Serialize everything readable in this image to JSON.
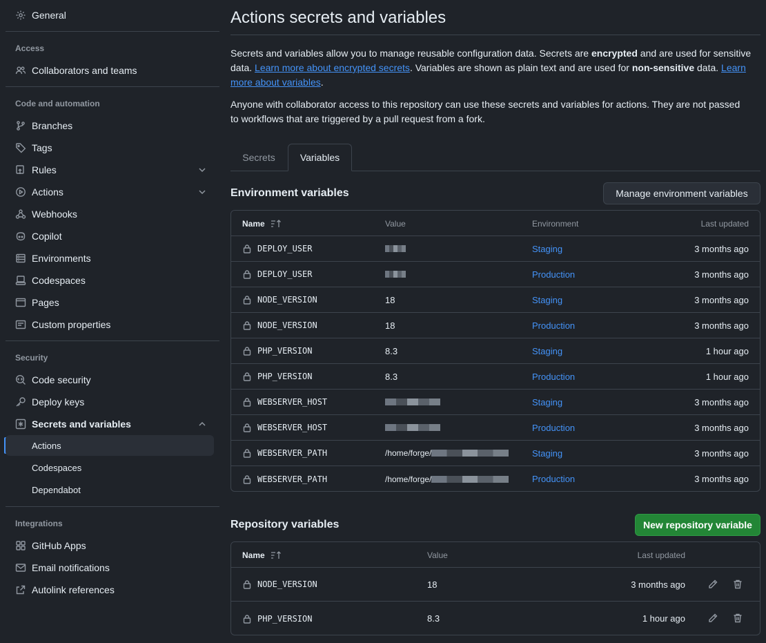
{
  "sidebar": {
    "general": "General",
    "section_access": "Access",
    "collaborators": "Collaborators and teams",
    "section_code": "Code and automation",
    "branches": "Branches",
    "tags": "Tags",
    "rules": "Rules",
    "actions": "Actions",
    "webhooks": "Webhooks",
    "copilot": "Copilot",
    "environments": "Environments",
    "codespaces": "Codespaces",
    "pages": "Pages",
    "custom_properties": "Custom properties",
    "section_security": "Security",
    "code_security": "Code security",
    "deploy_keys": "Deploy keys",
    "secrets_variables": "Secrets and variables",
    "sub_actions": "Actions",
    "sub_codespaces": "Codespaces",
    "sub_dependabot": "Dependabot",
    "section_integrations": "Integrations",
    "github_apps": "GitHub Apps",
    "email_notifications": "Email notifications",
    "autolink_references": "Autolink references"
  },
  "main": {
    "title": "Actions secrets and variables",
    "intro": {
      "t1": "Secrets and variables allow you to manage reusable configuration data. Secrets are ",
      "b1": "encrypted",
      "t2": " and are used for sensitive data. ",
      "link1": "Learn more about encrypted secrets",
      "t3": ". Variables are shown as plain text and are used for ",
      "b2": "non-sensitive",
      "t4": " data. ",
      "link2": "Learn more about variables",
      "t5": "."
    },
    "access_note": "Anyone with collaborator access to this repository can use these secrets and variables for actions. They are not passed to workflows that are triggered by a pull request from a fork.",
    "tabs": {
      "secrets": "Secrets",
      "variables": "Variables"
    },
    "env_section": {
      "title": "Environment variables",
      "manage_button": "Manage environment variables",
      "headers": {
        "name": "Name",
        "value": "Value",
        "environment": "Environment",
        "last_updated": "Last updated"
      },
      "rows": [
        {
          "name": "DEPLOY_USER",
          "value": "",
          "environment": "Staging",
          "updated": "3 months ago"
        },
        {
          "name": "DEPLOY_USER",
          "value": "",
          "environment": "Production",
          "updated": "3 months ago"
        },
        {
          "name": "NODE_VERSION",
          "value": "18",
          "environment": "Staging",
          "updated": "3 months ago"
        },
        {
          "name": "NODE_VERSION",
          "value": "18",
          "environment": "Production",
          "updated": "3 months ago"
        },
        {
          "name": "PHP_VERSION",
          "value": "8.3",
          "environment": "Staging",
          "updated": "1 hour ago"
        },
        {
          "name": "PHP_VERSION",
          "value": "8.3",
          "environment": "Production",
          "updated": "1 hour ago"
        },
        {
          "name": "WEBSERVER_HOST",
          "value": "",
          "environment": "Staging",
          "updated": "3 months ago"
        },
        {
          "name": "WEBSERVER_HOST",
          "value": "",
          "environment": "Production",
          "updated": "3 months ago"
        },
        {
          "name": "WEBSERVER_PATH",
          "value": "/home/forge/",
          "environment": "Staging",
          "updated": "3 months ago"
        },
        {
          "name": "WEBSERVER_PATH",
          "value": "/home/forge/",
          "environment": "Production",
          "updated": "3 months ago"
        }
      ]
    },
    "repo_section": {
      "title": "Repository variables",
      "new_button": "New repository variable",
      "headers": {
        "name": "Name",
        "value": "Value",
        "last_updated": "Last updated"
      },
      "rows": [
        {
          "name": "NODE_VERSION",
          "value": "18",
          "updated": "3 months ago"
        },
        {
          "name": "PHP_VERSION",
          "value": "8.3",
          "updated": "1 hour ago"
        }
      ]
    }
  }
}
